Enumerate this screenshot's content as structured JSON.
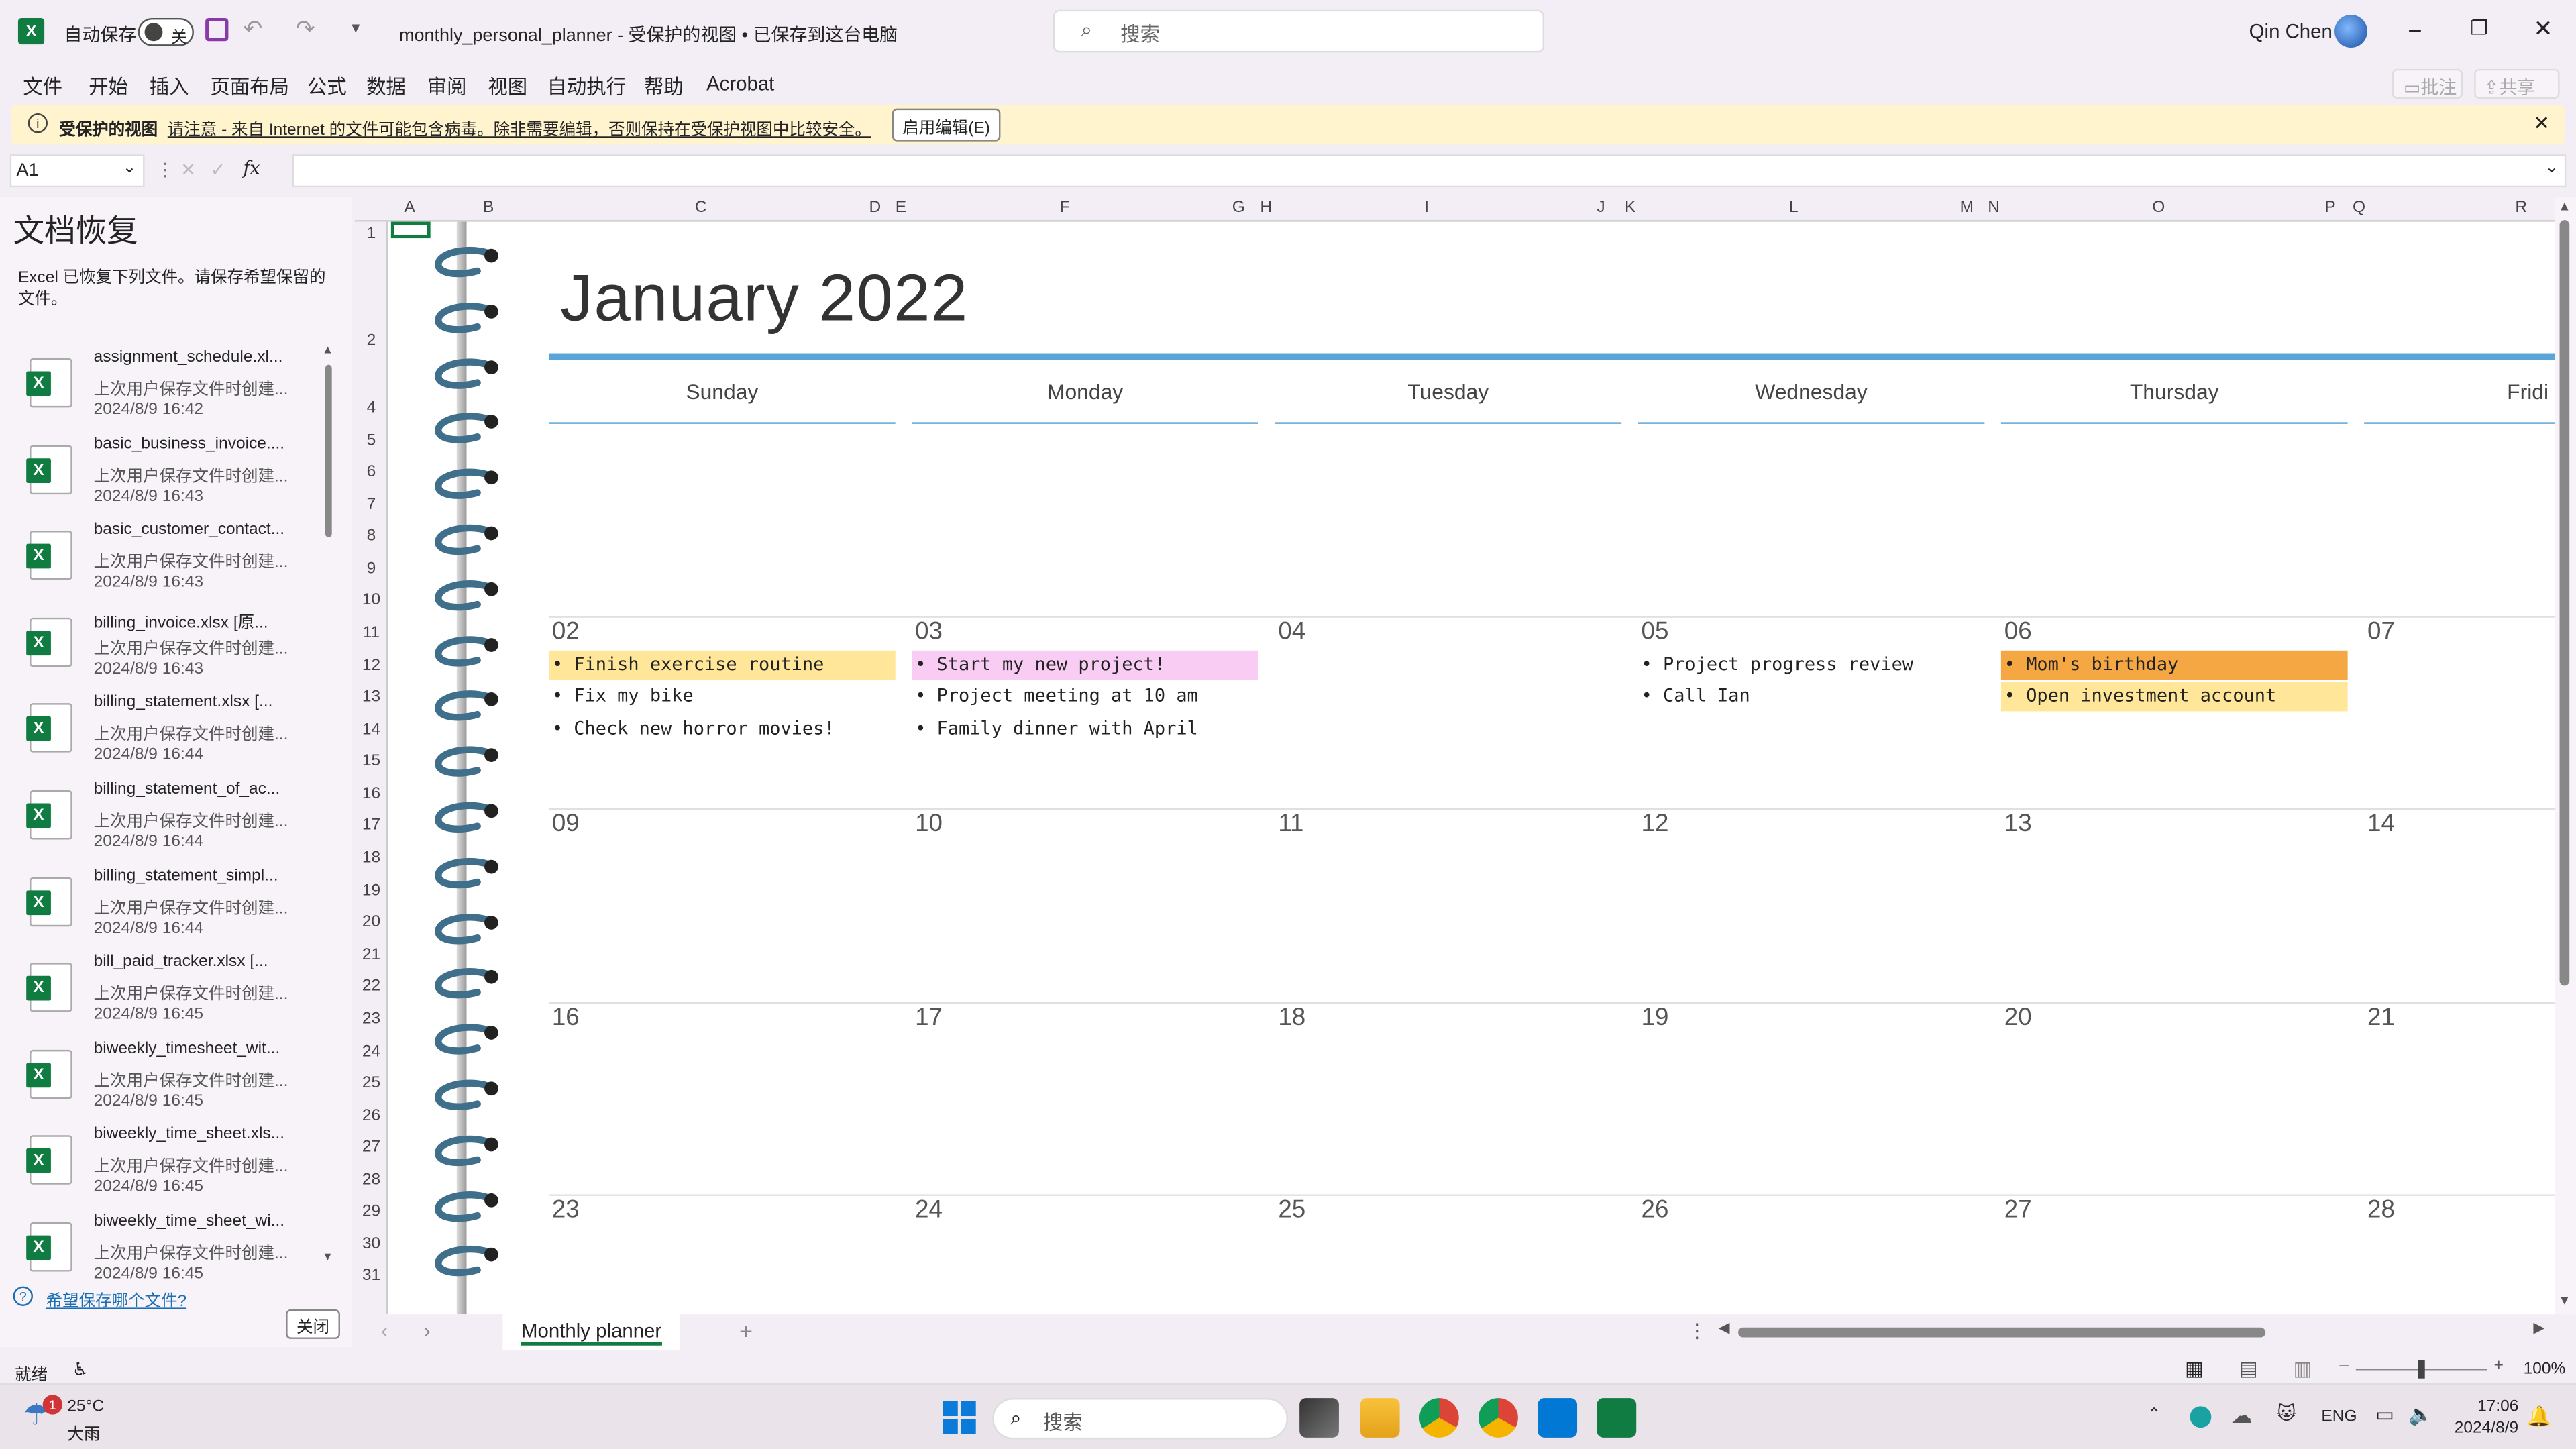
{
  "titlebar": {
    "autosave_label": "自动保存",
    "autosave_state": "关",
    "doc_title": "monthly_personal_planner  -  受保护的视图 • 已保存到这台电脑",
    "search_placeholder": "搜索",
    "user_name": "Qin Chen"
  },
  "menu": {
    "items": [
      "文件",
      "开始",
      "插入",
      "页面布局",
      "公式",
      "数据",
      "审阅",
      "视图",
      "自动执行",
      "帮助",
      "Acrobat"
    ],
    "comment_label": "批注",
    "share_label": "共享"
  },
  "protected_bar": {
    "title": "受保护的视图",
    "message": "请注意 - 来自 Internet 的文件可能包含病毒。除非需要编辑，否则保持在受保护视图中比较安全。",
    "enable_button": "启用编辑(E)"
  },
  "formula_bar": {
    "name_box": "A1",
    "fx": "fx",
    "value": ""
  },
  "recovery": {
    "title": "文档恢复",
    "description": "Excel 已恢复下列文件。请保存希望保留的文件。",
    "help_link": "希望保存哪个文件?",
    "close_button": "关闭",
    "items": [
      {
        "name": "assignment_schedule.xl...",
        "status": "上次用户保存文件时创建...",
        "time": "2024/8/9 16:42"
      },
      {
        "name": "basic_business_invoice....",
        "status": "上次用户保存文件时创建...",
        "time": "2024/8/9 16:43"
      },
      {
        "name": "basic_customer_contact...",
        "status": "上次用户保存文件时创建...",
        "time": "2024/8/9 16:43"
      },
      {
        "name": "billing_invoice.xlsx  [原...",
        "status": "上次用户保存文件时创建...",
        "time": "2024/8/9 16:43"
      },
      {
        "name": "billing_statement.xlsx  [...",
        "status": "上次用户保存文件时创建...",
        "time": "2024/8/9 16:44"
      },
      {
        "name": "billing_statement_of_ac...",
        "status": "上次用户保存文件时创建...",
        "time": "2024/8/9 16:44"
      },
      {
        "name": "billing_statement_simpl...",
        "status": "上次用户保存文件时创建...",
        "time": "2024/8/9 16:44"
      },
      {
        "name": "bill_paid_tracker.xlsx  [...",
        "status": "上次用户保存文件时创建...",
        "time": "2024/8/9 16:45"
      },
      {
        "name": "biweekly_timesheet_wit...",
        "status": "上次用户保存文件时创建...",
        "time": "2024/8/9 16:45"
      },
      {
        "name": "biweekly_time_sheet.xls...",
        "status": "上次用户保存文件时创建...",
        "time": "2024/8/9 16:45"
      },
      {
        "name": "biweekly_time_sheet_wi...",
        "status": "上次用户保存文件时创建...",
        "time": "2024/8/9 16:45"
      }
    ]
  },
  "columns": [
    "A",
    "B",
    "C",
    "D",
    "E",
    "F",
    "G",
    "H",
    "I",
    "J",
    "K",
    "L",
    "M",
    "N",
    "O",
    "P",
    "Q",
    "R"
  ],
  "rows": [
    "1",
    "2",
    "4",
    "5",
    "6",
    "7",
    "8",
    "9",
    "10",
    "11",
    "12",
    "13",
    "14",
    "15",
    "16",
    "17",
    "18",
    "19",
    "20",
    "21",
    "22",
    "23",
    "24",
    "25",
    "26",
    "27",
    "28",
    "29",
    "30",
    "31"
  ],
  "planner": {
    "month_title": "January 2022",
    "days": [
      "Sunday",
      "Monday",
      "Tuesday",
      "Wednesday",
      "Thursday",
      "Fridi"
    ],
    "weeks": [
      [
        "02",
        "03",
        "04",
        "05",
        "06",
        "07"
      ],
      [
        "09",
        "10",
        "11",
        "12",
        "13",
        "14"
      ],
      [
        "16",
        "17",
        "18",
        "19",
        "20",
        "21"
      ],
      [
        "23",
        "24",
        "25",
        "26",
        "27",
        "28"
      ]
    ],
    "events": {
      "sun1": "• Finish exercise routine",
      "sun2": "• Fix my bike",
      "sun3": "• Check new horror movies!",
      "mon1": "• Start my new project!",
      "mon2": "• Project meeting at 10 am",
      "mon3": "• Family dinner with April",
      "wed1": "• Project progress review",
      "wed2": "• Call Ian",
      "thu1": "• Mom's birthday",
      "thu2": "• Open investment account"
    },
    "colors": {
      "yellow": "#ffe699",
      "pink": "#f9ccf4",
      "orange": "#f4a742",
      "accent": "#5aa5d8"
    }
  },
  "sheet_tab": "Monthly planner",
  "status": {
    "ready": "就绪",
    "zoom": "100%"
  },
  "taskbar": {
    "weather_temp": "25°C",
    "weather_desc": "大雨",
    "weather_badge": "1",
    "search": "搜索",
    "lang": "ENG",
    "time": "17:06",
    "date": "2024/8/9"
  }
}
